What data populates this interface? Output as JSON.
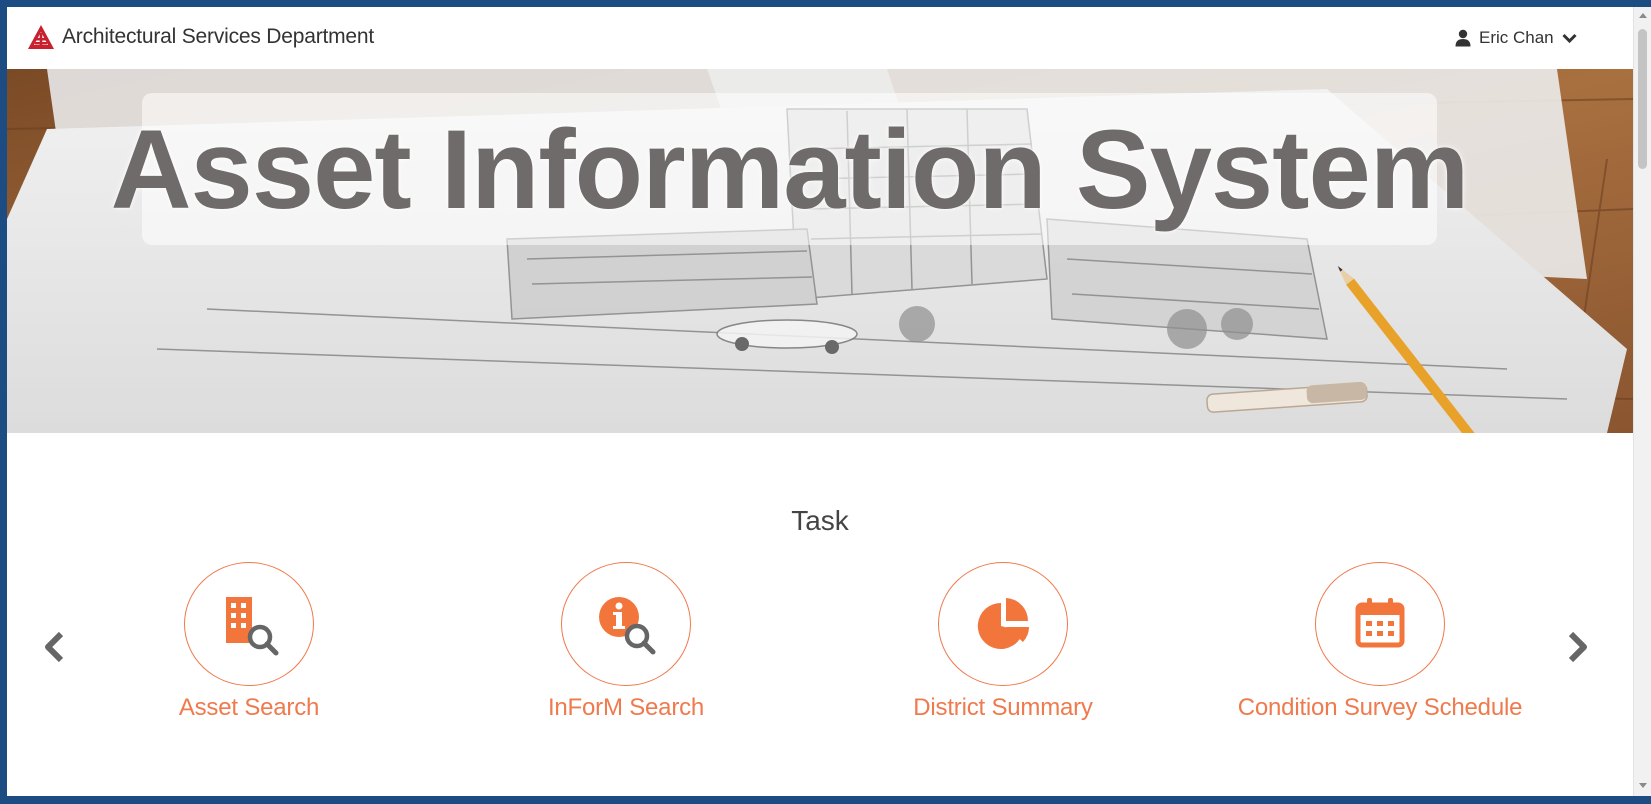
{
  "navbar": {
    "brand_name": "Architectural Services Department",
    "brand_logo_icon": "asd-logo-icon",
    "user_name": "Eric Chan",
    "user_icon": "user-icon",
    "dropdown_icon": "chevron-down-icon"
  },
  "hero": {
    "title": "Asset Information System"
  },
  "tasks": {
    "heading": "Task",
    "items": [
      {
        "label": "Asset Search",
        "icon": "building-search-icon"
      },
      {
        "label": "InForM Search",
        "icon": "info-search-icon"
      },
      {
        "label": "District Summary",
        "icon": "pie-chart-icon"
      },
      {
        "label": "Condition Survey Schedule",
        "icon": "calendar-icon"
      }
    ],
    "prev_icon": "chevron-left-icon",
    "next_icon": "chevron-right-icon"
  },
  "colors": {
    "accent": "#ef7a4d",
    "frame": "#1d4c82",
    "text": "#333333",
    "logo_red": "#c8202f"
  }
}
